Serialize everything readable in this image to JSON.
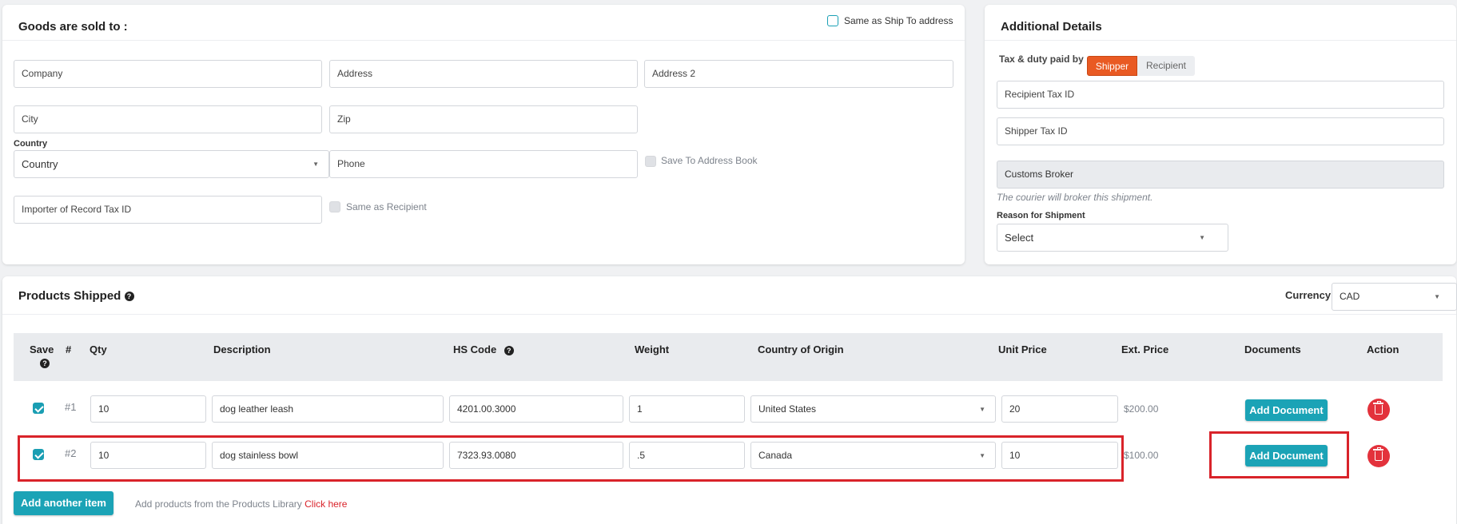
{
  "sold_to": {
    "title": "Goods are sold to :",
    "same_as_ship": "Same as Ship To address",
    "company_ph": "Company",
    "address_ph": "Address",
    "address2_ph": "Address 2",
    "city_ph": "City",
    "zip_ph": "Zip",
    "country_label": "Country",
    "country_value": "Country",
    "phone_ph": "Phone",
    "save_address_book": "Save To Address Book",
    "importer_tax_ph": "Importer of Record Tax ID",
    "same_as_recipient": "Same as Recipient"
  },
  "additional": {
    "title": "Additional Details",
    "tax_paid_label": "Tax & duty paid by",
    "shipper": "Shipper",
    "recipient": "Recipient",
    "recipient_tax_ph": "Recipient Tax ID",
    "shipper_tax_ph": "Shipper Tax ID",
    "customs_broker": "Customs Broker",
    "broker_note": "The courier will broker this shipment.",
    "reason_label": "Reason for Shipment",
    "reason_value": "Select",
    "accent": "#e95a23"
  },
  "products": {
    "title": "Products Shipped",
    "currency_label": "Currency",
    "currency_value": "CAD",
    "headers": {
      "save": "Save",
      "num": "#",
      "qty": "Qty",
      "description": "Description",
      "hs_code": "HS Code",
      "weight": "Weight",
      "origin": "Country of Origin",
      "unit_price": "Unit Price",
      "ext_price": "Ext. Price",
      "documents": "Documents",
      "action": "Action"
    },
    "rows": [
      {
        "num": "#1",
        "qty": "10",
        "description": "dog leather leash",
        "hs_code": "4201.00.3000",
        "weight": "1",
        "origin": "United States",
        "unit_price": "20",
        "ext_price": "$200.00",
        "doc_button": "Add Document"
      },
      {
        "num": "#2",
        "qty": "10",
        "description": "dog stainless bowl",
        "hs_code": "7323.93.0080",
        "weight": ".5",
        "origin": "Canada",
        "unit_price": "10",
        "ext_price": "$100.00",
        "doc_button": "Add Document"
      }
    ],
    "add_item": "Add another item",
    "library_text": "Add products from the Products Library",
    "click_here": "Click here",
    "teal": "#1ba3b6",
    "highlight": "#d9232a"
  }
}
